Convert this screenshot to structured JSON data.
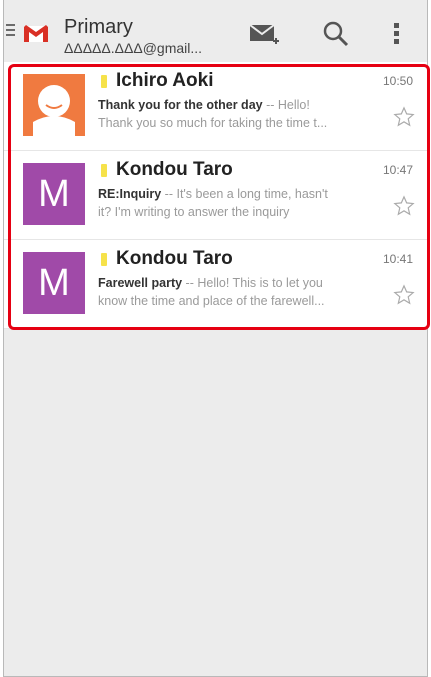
{
  "header": {
    "title": "Primary",
    "account": "ΔΔΔΔΔ.ΔΔΔ@gmail...",
    "menu_icon": "menu-icon",
    "logo_icon": "gmail-logo",
    "compose_icon": "compose-icon",
    "search_icon": "search-icon",
    "overflow_icon": "overflow-menu-icon"
  },
  "emails": [
    {
      "sender": "Ichiro Aoki",
      "time": "10:50",
      "subject": "Thank you for the other day",
      "snippet_1": " -- Hello!",
      "snippet_2": "Thank you so much for taking the time t...",
      "avatar_type": "photo",
      "avatar_letter": ""
    },
    {
      "sender": "Kondou Taro",
      "time": "10:47",
      "subject": "RE:Inquiry",
      "snippet_1": " -- It's been a long time, hasn't",
      "snippet_2": "it? I'm writing to answer the inquiry",
      "avatar_type": "letter",
      "avatar_letter": "M"
    },
    {
      "sender": "Kondou Taro",
      "time": "10:41",
      "subject": "Farewell party",
      "snippet_1": " -- Hello! This is to let you",
      "snippet_2": "know the time and place of the farewell...",
      "avatar_type": "letter",
      "avatar_letter": "M"
    }
  ],
  "colors": {
    "highlight_border": "#e60012",
    "avatar_letter_bg": "#a04aa8",
    "avatar_photo_bg": "#f07a40",
    "important_marker": "#f6e24a",
    "gmail_red": "#d93025"
  }
}
